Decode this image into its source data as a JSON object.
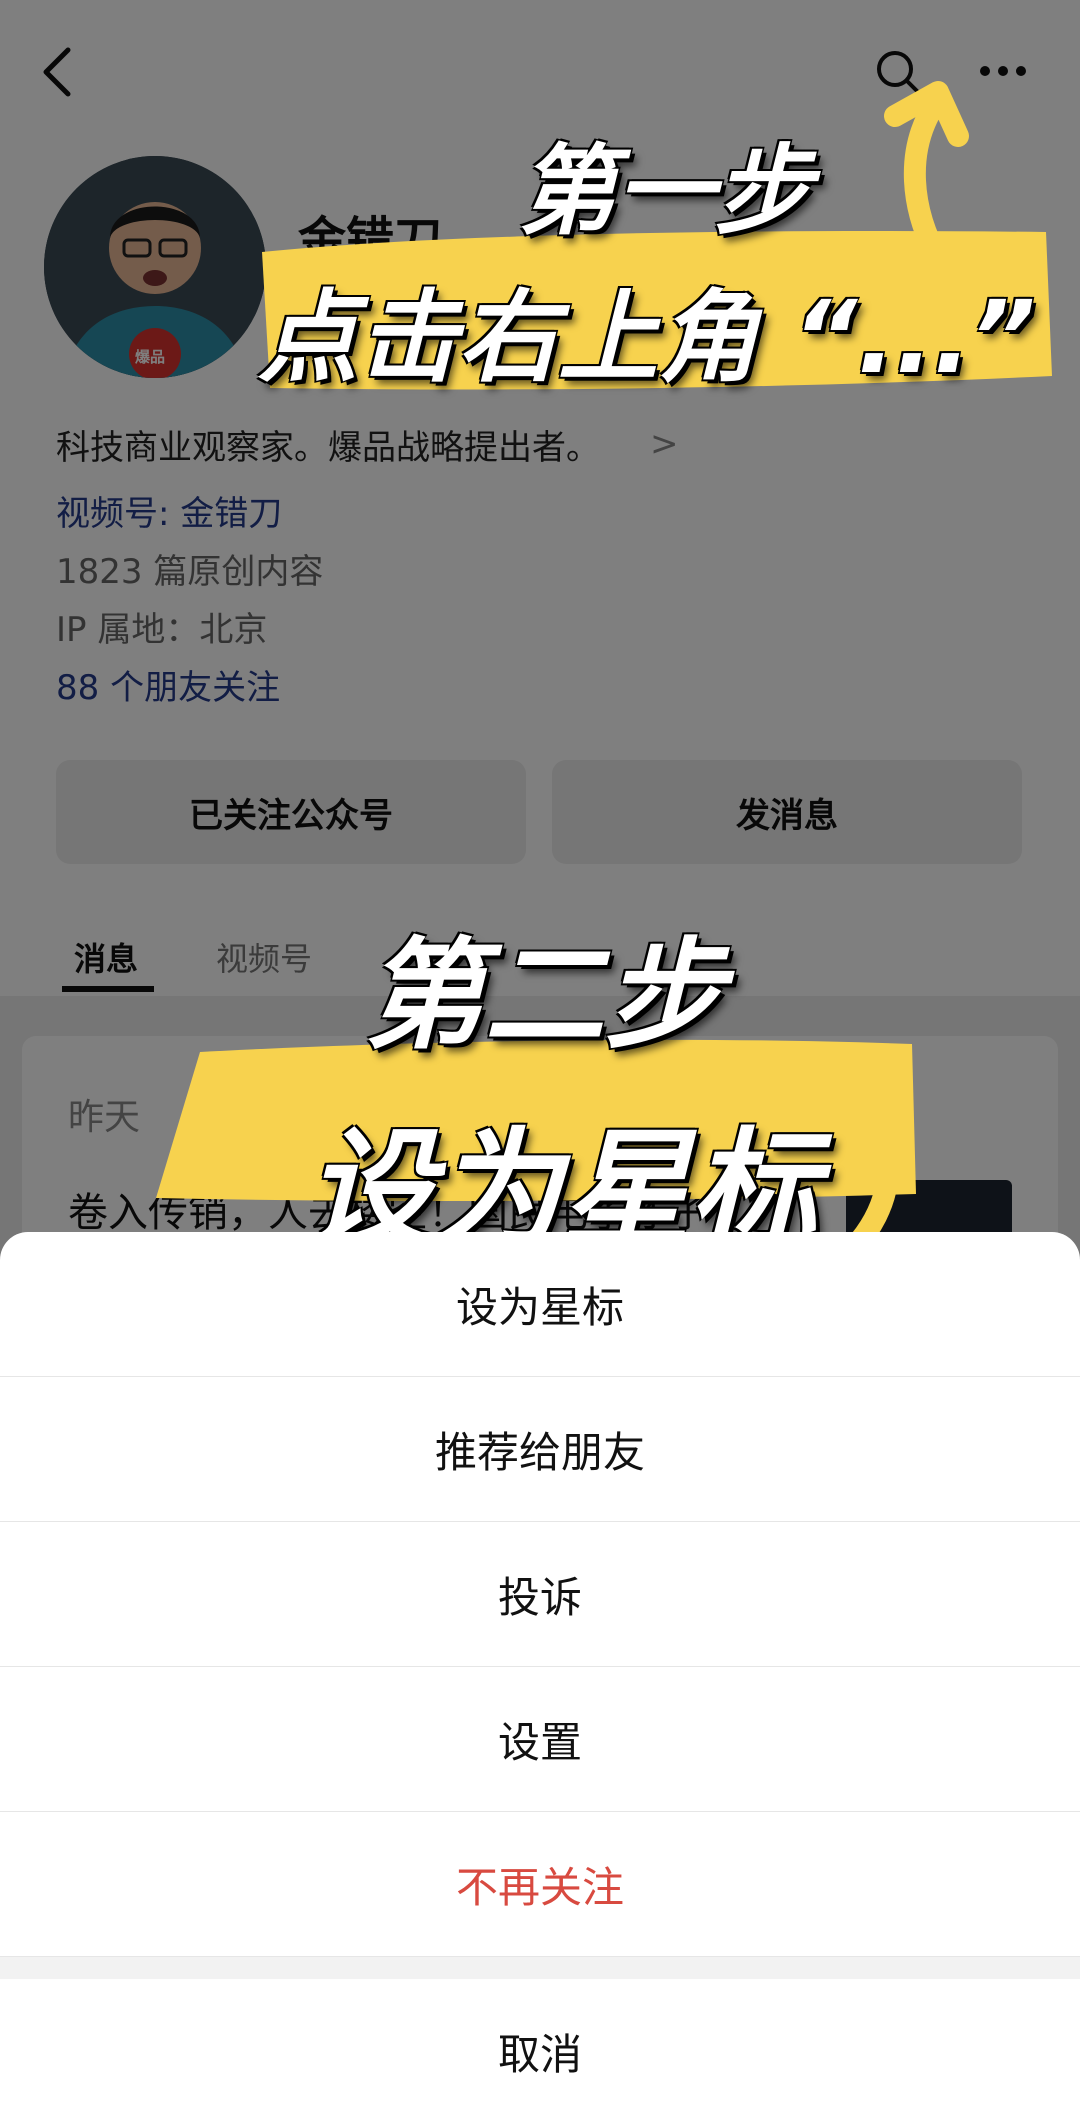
{
  "profile": {
    "name": "金错刀",
    "avatar_badge": "爆品",
    "bio": "科技商业观察家。爆品战略提出者。",
    "bio_arrow": ">",
    "channel": "视频号: 金错刀",
    "article_count": "1823 篇原创内容",
    "ip_location": "IP 属地：北京",
    "friends_following": "88 个朋友关注"
  },
  "actions": {
    "follow_label": "已关注公众号",
    "message_label": "发消息"
  },
  "tabs": [
    {
      "label": "消息",
      "active": true
    },
    {
      "label": "视频号",
      "active": false
    }
  ],
  "feed": {
    "date": "昨天",
    "title": "卷入传销，人去楼空！国民电子才子"
  },
  "annotations": {
    "step1": "第一步",
    "step1_instruction": "点击右上角 “...”",
    "step2": "第二步",
    "step2_instruction": "设为星标",
    "highlight_color": "#f7d24e"
  },
  "sheet": {
    "items": [
      "设为星标",
      "推荐给朋友",
      "投诉",
      "设置",
      "不再关注"
    ],
    "danger_color": "#d84a40",
    "cancel_label": "取消"
  },
  "icons": [
    "back-icon",
    "search-icon",
    "more-icon"
  ]
}
